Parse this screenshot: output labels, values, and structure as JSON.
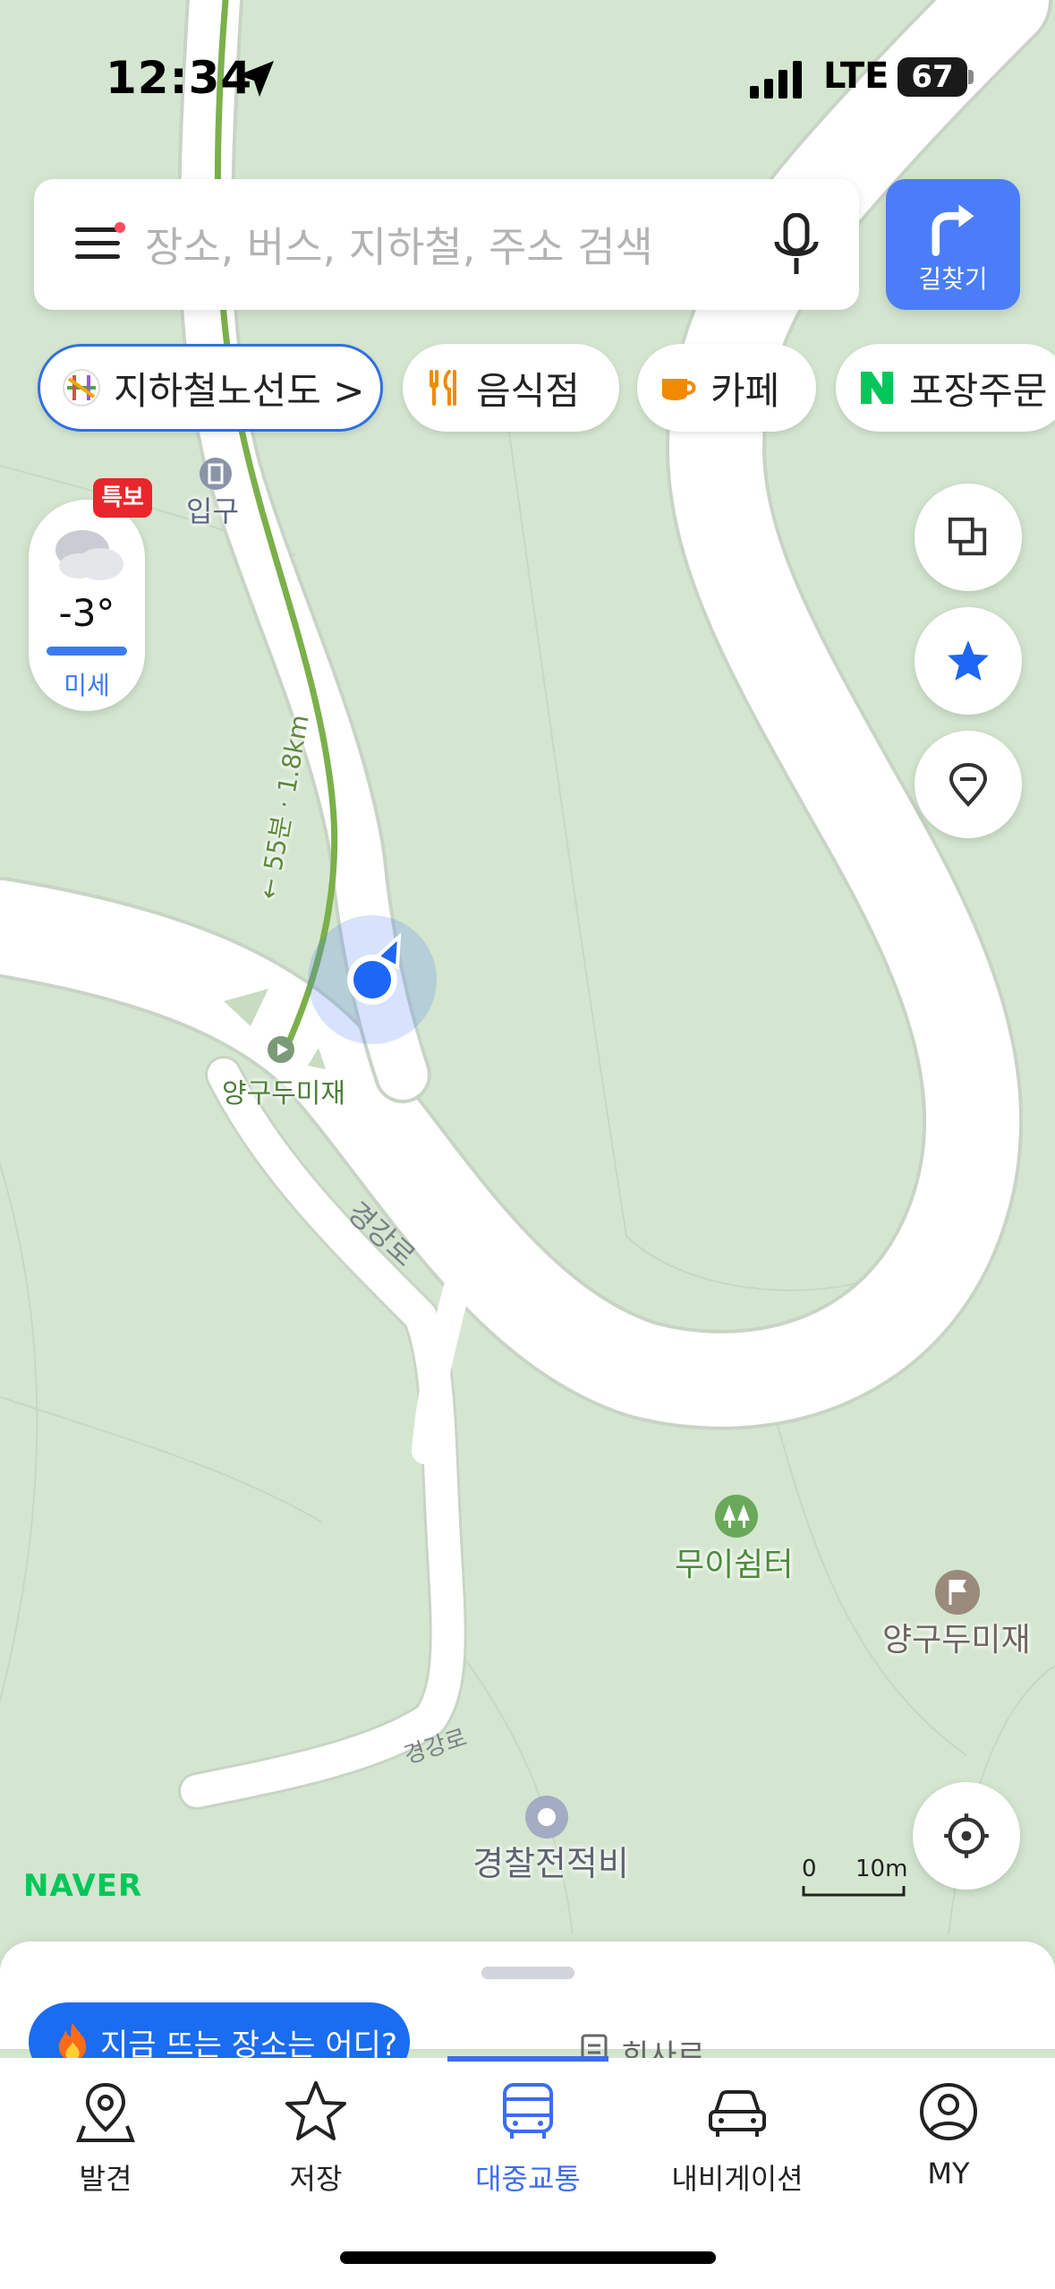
{
  "status_bar": {
    "time": "12:34",
    "network": "LTE",
    "battery": "67"
  },
  "search": {
    "placeholder": "장소, 버스, 지하철, 주소 검색",
    "route_label": "길찾기"
  },
  "chips": [
    {
      "label": "지하철노선도 >",
      "icon": "subway-map-icon"
    },
    {
      "label": "음식점",
      "icon": "restaurant-icon"
    },
    {
      "label": "카페",
      "icon": "cafe-icon"
    },
    {
      "label": "포장주문",
      "icon": "naver-n-icon"
    }
  ],
  "weather": {
    "alert": "특보",
    "temperature": "-3°",
    "dust": "미세"
  },
  "map_labels": {
    "entrance": "입구",
    "route_distance": "← 55분 · 1.8km",
    "place_yanggu_1": "양구두미재",
    "road_1": "경강로",
    "shelter": "무이쉼터",
    "place_yanggu_2": "양구두미재",
    "road_2": "경강로",
    "monument": "경찰전적비"
  },
  "scale": {
    "zero": "0",
    "distance": "10m"
  },
  "brand": "NAVER",
  "sheet": {
    "trend_label": "지금 뜨는 장소는 어디?",
    "peek_text": "희사로"
  },
  "tabs": [
    {
      "label": "발견",
      "icon": "map-pin-icon",
      "active": false
    },
    {
      "label": "저장",
      "icon": "star-icon",
      "active": false
    },
    {
      "label": "대중교통",
      "icon": "bus-icon",
      "active": true
    },
    {
      "label": "내비게이션",
      "icon": "car-icon",
      "active": false
    },
    {
      "label": "MY",
      "icon": "profile-icon",
      "active": false
    }
  ],
  "colors": {
    "accent": "#4a7df7",
    "map_bg": "#d4e6d0",
    "road": "#ffffff",
    "trail": "#7bb04a",
    "naver_green": "#03c75a",
    "alert_red": "#e8262c"
  }
}
